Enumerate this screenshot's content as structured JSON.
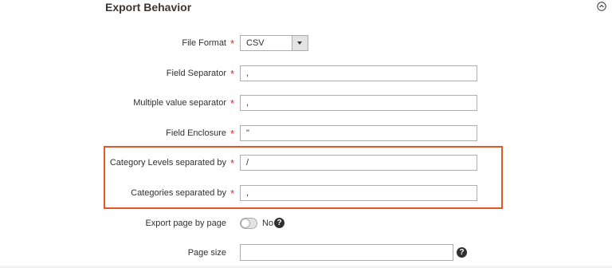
{
  "section": {
    "title": "Export Behavior"
  },
  "fields": {
    "file_format": {
      "label": "File Format",
      "value": "CSV",
      "required_mark": "*"
    },
    "field_separator": {
      "label": "Field Separator",
      "value": ",",
      "required_mark": "*"
    },
    "multiple_value_separator": {
      "label": "Multiple value separator",
      "value": ",",
      "required_mark": "*"
    },
    "field_enclosure": {
      "label": "Field Enclosure",
      "value": "\"",
      "required_mark": "*"
    },
    "category_levels_separator": {
      "label": "Category Levels separated by",
      "value": "/",
      "required_mark": "*"
    },
    "categories_separator": {
      "label": "Categories separated by",
      "value": ",",
      "required_mark": "*"
    },
    "export_page_by_page": {
      "label": "Export page by page",
      "toggle_state": "No",
      "help_icon": "question-circle-icon"
    },
    "page_size": {
      "label": "Page size",
      "value": "",
      "help_icon": "question-circle-icon"
    }
  },
  "icons": {
    "collapse": "chevron-up-circle-icon"
  },
  "colors": {
    "required": "#e22626",
    "highlight": "#e2562a",
    "toggle_off": "#e3e3e3"
  }
}
